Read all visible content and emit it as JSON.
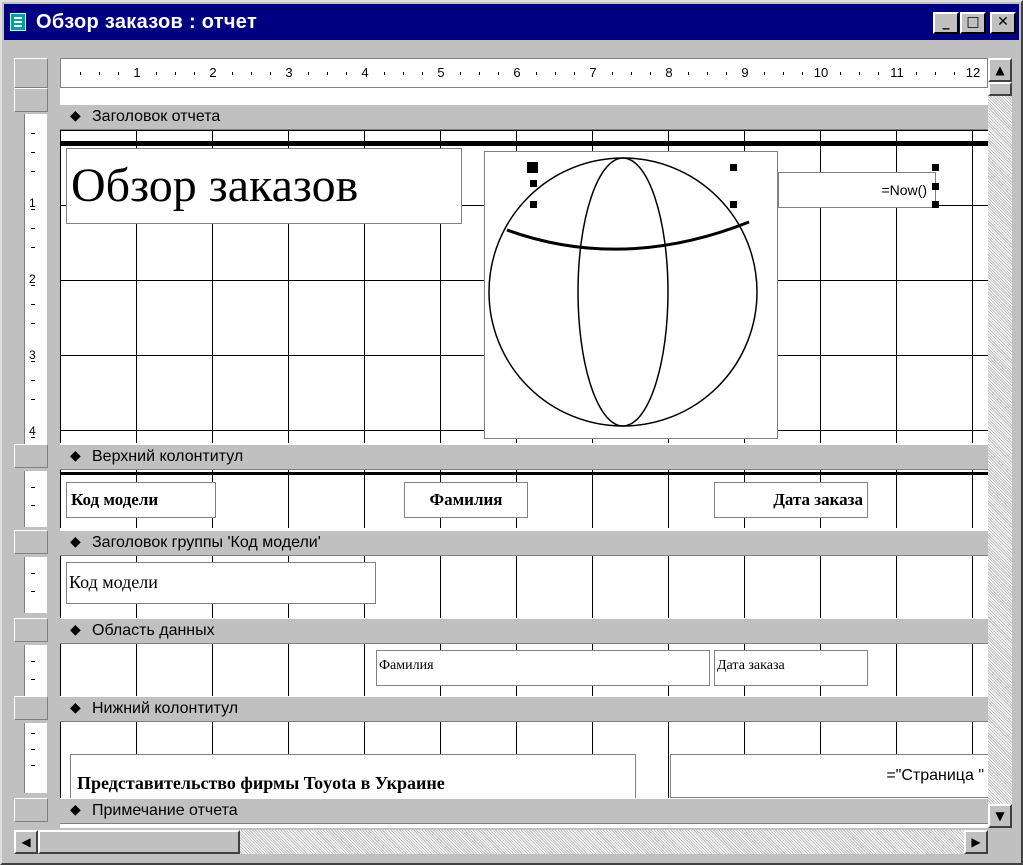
{
  "window": {
    "title": "Обзор заказов : отчет",
    "minimize_glyph": "_",
    "maximize_glyph": "□",
    "close_glyph": "✕"
  },
  "ruler": {
    "numbers": [
      "1",
      "2",
      "3",
      "4",
      "5",
      "6",
      "7",
      "8",
      "9",
      "10",
      "11",
      "12"
    ],
    "vertical_numbers": [
      "1",
      "2",
      "3",
      "4"
    ]
  },
  "sections": {
    "report_header": "Заголовок отчета",
    "page_header": "Верхний колонтитул",
    "group_header": "Заголовок группы 'Код модели'",
    "detail": "Область данных",
    "page_footer": "Нижний колонтитул",
    "report_footer": "Примечание отчета"
  },
  "controls": {
    "report_title": "Обзор заказов",
    "now_field": "=Now()",
    "label_model_code": "Код модели",
    "label_surname": "Фамилия",
    "label_order_date": "Дата заказа",
    "group_model_code": "Код модели",
    "field_surname": "Фамилия",
    "field_order_date": "Дата заказа",
    "footer_company": "Представительство фирмы Toyota в Украине",
    "footer_page": "=\"Страница \""
  },
  "icons": {
    "section_arrow": "section-arrow-icon",
    "scroll_up": "scroll-up-icon",
    "scroll_down": "scroll-down-icon",
    "scroll_left": "scroll-left-icon",
    "scroll_right": "scroll-right-icon"
  },
  "colors": {
    "titlebar": "#000080",
    "face": "#c0c0c0",
    "canvas": "#ffffff"
  }
}
